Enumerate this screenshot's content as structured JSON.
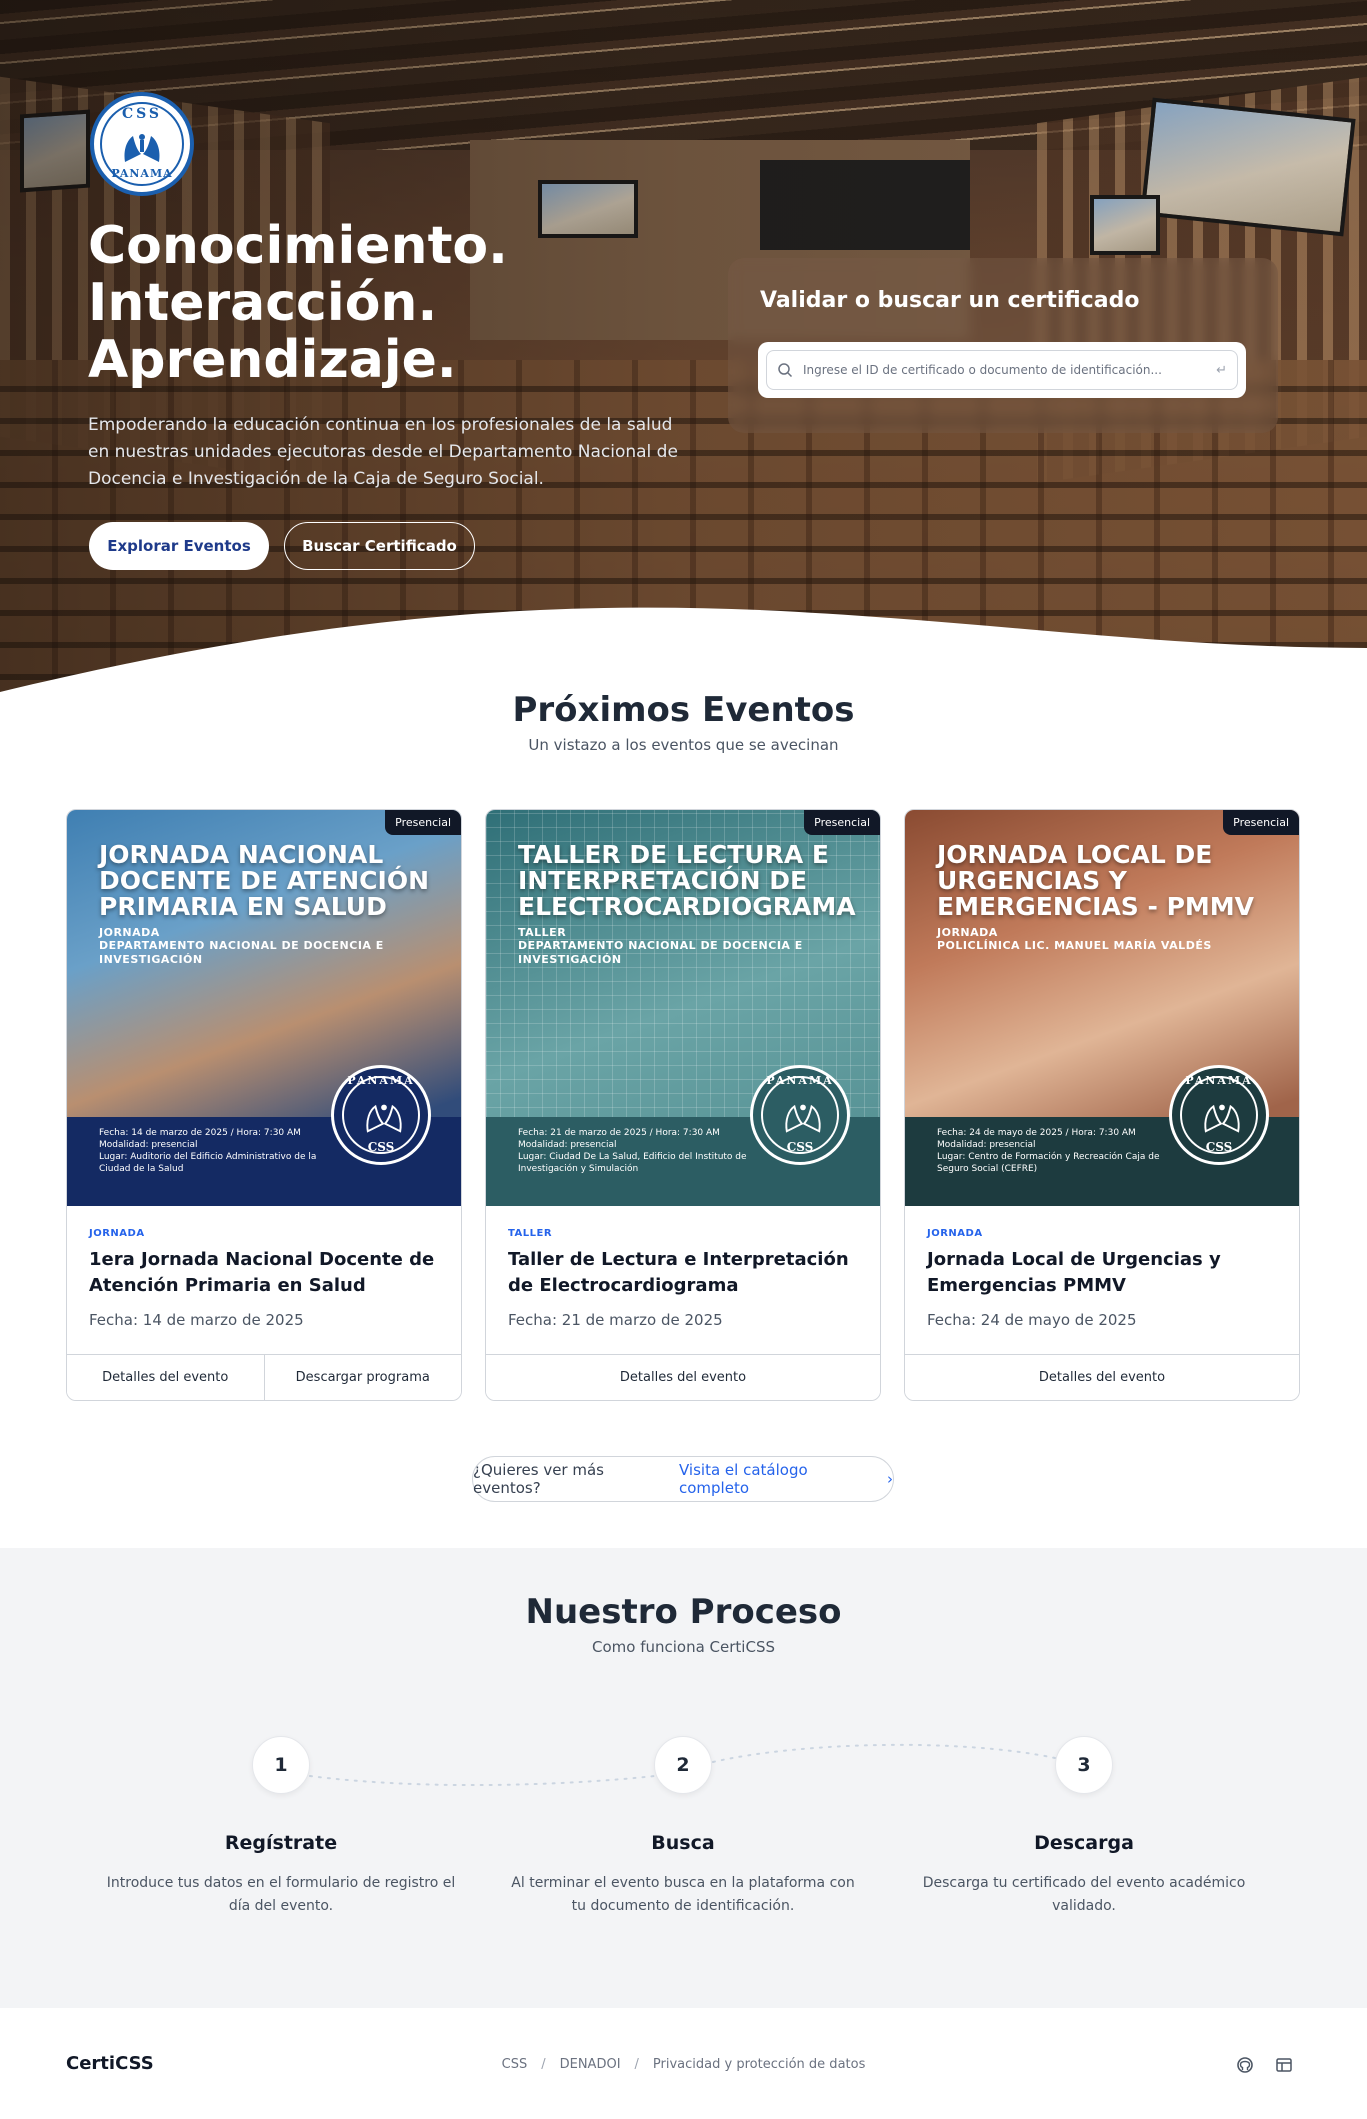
{
  "hero": {
    "logo_top": "CSS",
    "logo_bottom": "PANAMA",
    "title_lines": [
      "Conocimiento.",
      "Interacción.",
      "Aprendizaje."
    ],
    "subtitle": "Empoderando la educación continua en los profesionales de la salud en nuestras unidades ejecutoras desde el Departamento Nacional de Docencia e Investigación de la Caja de Seguro Social.",
    "primary_button": "Explorar Eventos",
    "secondary_button": "Buscar Certificado"
  },
  "search": {
    "title": "Validar o buscar un certificado",
    "placeholder": "Ingrese el ID de certificado o documento de identificación...",
    "enter_glyph": "↵"
  },
  "events": {
    "title": "Próximos Eventos",
    "subtitle": "Un vistazo a los eventos que se avecinan",
    "cards": [
      {
        "badge": "Presencial",
        "poster_title": "Jornada Nacional Docente de Atención Primaria en Salud",
        "poster_type": "Jornada",
        "poster_org": "Departamento Nacional de Docencia e Investigación",
        "poster_date": "Fecha: 14 de marzo de 2025 / Hora: 7:30 AM",
        "poster_mode": "Modalidad: presencial",
        "poster_place": "Lugar: Auditorio del Edificio Administrativo de la Ciudad de la Salud",
        "seal_top": "PANAMA",
        "seal_bottom": "CSS",
        "category": "JORNADA",
        "title": "1era Jornada Nacional Docente de Atención Primaria en Salud",
        "date": "Fecha: 14 de marzo de 2025",
        "actions": [
          "Detalles del evento",
          "Descargar programa"
        ]
      },
      {
        "badge": "Presencial",
        "poster_title": "Taller de Lectura e Interpretación de Electrocardiograma",
        "poster_type": "Taller",
        "poster_org": "Departamento Nacional de Docencia e Investigación",
        "poster_date": "Fecha: 21 de marzo de 2025 / Hora: 7:30 AM",
        "poster_mode": "Modalidad: presencial",
        "poster_place": "Lugar: Ciudad De La Salud, Edificio del Instituto de Investigación y Simulación",
        "seal_top": "PANAMA",
        "seal_bottom": "CSS",
        "category": "TALLER",
        "title": "Taller de Lectura e Interpretación de Electrocardiograma",
        "date": "Fecha: 21 de marzo de 2025",
        "actions": [
          "Detalles del evento"
        ]
      },
      {
        "badge": "Presencial",
        "poster_title": "Jornada Local de Urgencias y Emergencias - PMMV",
        "poster_type": "Jornada",
        "poster_org": "Policlínica Lic. Manuel María Valdés",
        "poster_date": "Fecha: 24 de mayo de 2025 / Hora: 7:30 AM",
        "poster_mode": "Modalidad: presencial",
        "poster_place": "Lugar: Centro de Formación y Recreación Caja de Seguro Social (CEFRE)",
        "seal_top": "PANAMA",
        "seal_bottom": "CSS",
        "category": "JORNADA",
        "title": "Jornada Local de Urgencias y Emergencias PMMV",
        "date": "Fecha: 24 de mayo de 2025",
        "actions": [
          "Detalles del evento"
        ]
      }
    ],
    "more_question": "¿Quieres ver más eventos?",
    "more_link": "Visita el catálogo completo",
    "more_chevron": "›"
  },
  "process": {
    "title": "Nuestro Proceso",
    "subtitle": "Como funciona CertiCSS",
    "steps": [
      {
        "number": "1",
        "title": "Regístrate",
        "description": "Introduce tus datos en el formulario de registro el día del evento."
      },
      {
        "number": "2",
        "title": "Busca",
        "description": "Al terminar el evento busca en la plataforma con tu documento de identificación."
      },
      {
        "number": "3",
        "title": "Descarga",
        "description": "Descarga tu certificado del evento académico validado."
      }
    ]
  },
  "footer": {
    "brand": "CertiCSS",
    "links": [
      "CSS",
      "DENADOI",
      "Privacidad y protección de datos"
    ],
    "separator": "/",
    "icons": [
      "github-icon",
      "layout-icon"
    ]
  },
  "colors": {
    "navy": "#1e3a8a",
    "link_blue": "#2563eb",
    "band_blue": "#142a63",
    "band_teal": "#2c5d63",
    "band_dark": "#1d3b3f"
  }
}
